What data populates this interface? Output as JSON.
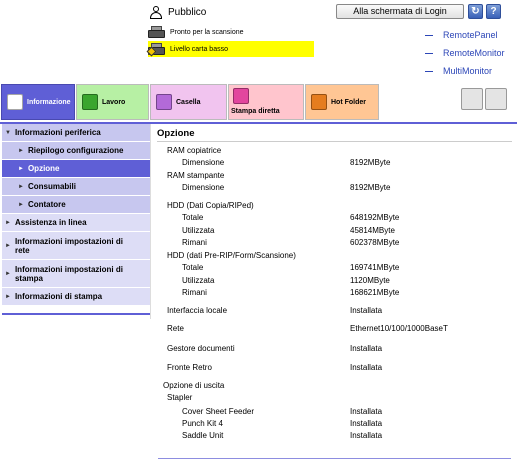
{
  "header": {
    "user": "Pubblico",
    "login_button": "Alla schermata di Login",
    "status_ready": "Pronto per la scansione",
    "status_warning": "Livello carta basso",
    "links": [
      "RemotePanel",
      "RemoteMonitor",
      "MultiMonitor"
    ]
  },
  "tabs": [
    {
      "label": "Informazione"
    },
    {
      "label": "Lavoro"
    },
    {
      "label": "Casella"
    },
    {
      "label": "Stampa diretta"
    },
    {
      "label": "Hot Folder"
    }
  ],
  "sidebar": {
    "items": [
      {
        "label": "Informazioni periferica",
        "level": 1,
        "state": "open"
      },
      {
        "label": "Riepilogo configurazione",
        "level": 2
      },
      {
        "label": "Opzione",
        "level": 2,
        "state": "selected"
      },
      {
        "label": "Consumabili",
        "level": 2
      },
      {
        "label": "Contatore",
        "level": 2
      },
      {
        "label": "Assistenza in linea",
        "level": 1
      },
      {
        "label": "Informazioni impostazioni di rete",
        "level": 1
      },
      {
        "label": "Informazioni impostazioni di stampa",
        "level": 1
      },
      {
        "label": "Informazioni di stampa",
        "level": 1
      }
    ]
  },
  "main": {
    "title": "Opzione",
    "rows": [
      {
        "label": "RAM copiatrice",
        "indent": 1,
        "value": ""
      },
      {
        "label": "Dimensione",
        "indent": 2,
        "value": "8192MByte"
      },
      {
        "label": "RAM stampante",
        "indent": 1,
        "value": ""
      },
      {
        "label": "Dimensione",
        "indent": 2,
        "value": "8192MByte"
      },
      {
        "label": "HDD (Dati Copia/RIPed)",
        "indent": 1,
        "value": ""
      },
      {
        "label": "Totale",
        "indent": 2,
        "value": "648192MByte"
      },
      {
        "label": "Utilizzata",
        "indent": 2,
        "value": "45814MByte"
      },
      {
        "label": "Rimani",
        "indent": 2,
        "value": "602378MByte"
      },
      {
        "label": "HDD (dati Pre-RIP/Form/Scansione)",
        "indent": 1,
        "value": ""
      },
      {
        "label": "Totale",
        "indent": 2,
        "value": "169741MByte"
      },
      {
        "label": "Utilizzata",
        "indent": 2,
        "value": "1120MByte"
      },
      {
        "label": "Rimani",
        "indent": 2,
        "value": "168621MByte"
      },
      {
        "label": "Interfaccia locale",
        "indent": 1,
        "value": "Installata"
      },
      {
        "label": "Rete",
        "indent": 1,
        "value": "Ethernet10/100/1000BaseT"
      },
      {
        "label": "Gestore documenti",
        "indent": 1,
        "value": "Installata"
      },
      {
        "label": "Fronte Retro",
        "indent": 1,
        "value": "Installata"
      },
      {
        "label": "Opzione di uscita",
        "indent": 0,
        "value": ""
      },
      {
        "label": "Stapler",
        "indent": 1,
        "value": ""
      },
      {
        "label": "Cover Sheet Feeder",
        "indent": 2,
        "value": "Installata"
      },
      {
        "label": "Punch Kit 4",
        "indent": 2,
        "value": "Installata"
      },
      {
        "label": "Saddle Unit",
        "indent": 2,
        "value": "Installata"
      }
    ]
  },
  "colors": {
    "accent": "#5f5fd6",
    "warning": "#ffff00",
    "link": "#2c46b7"
  }
}
